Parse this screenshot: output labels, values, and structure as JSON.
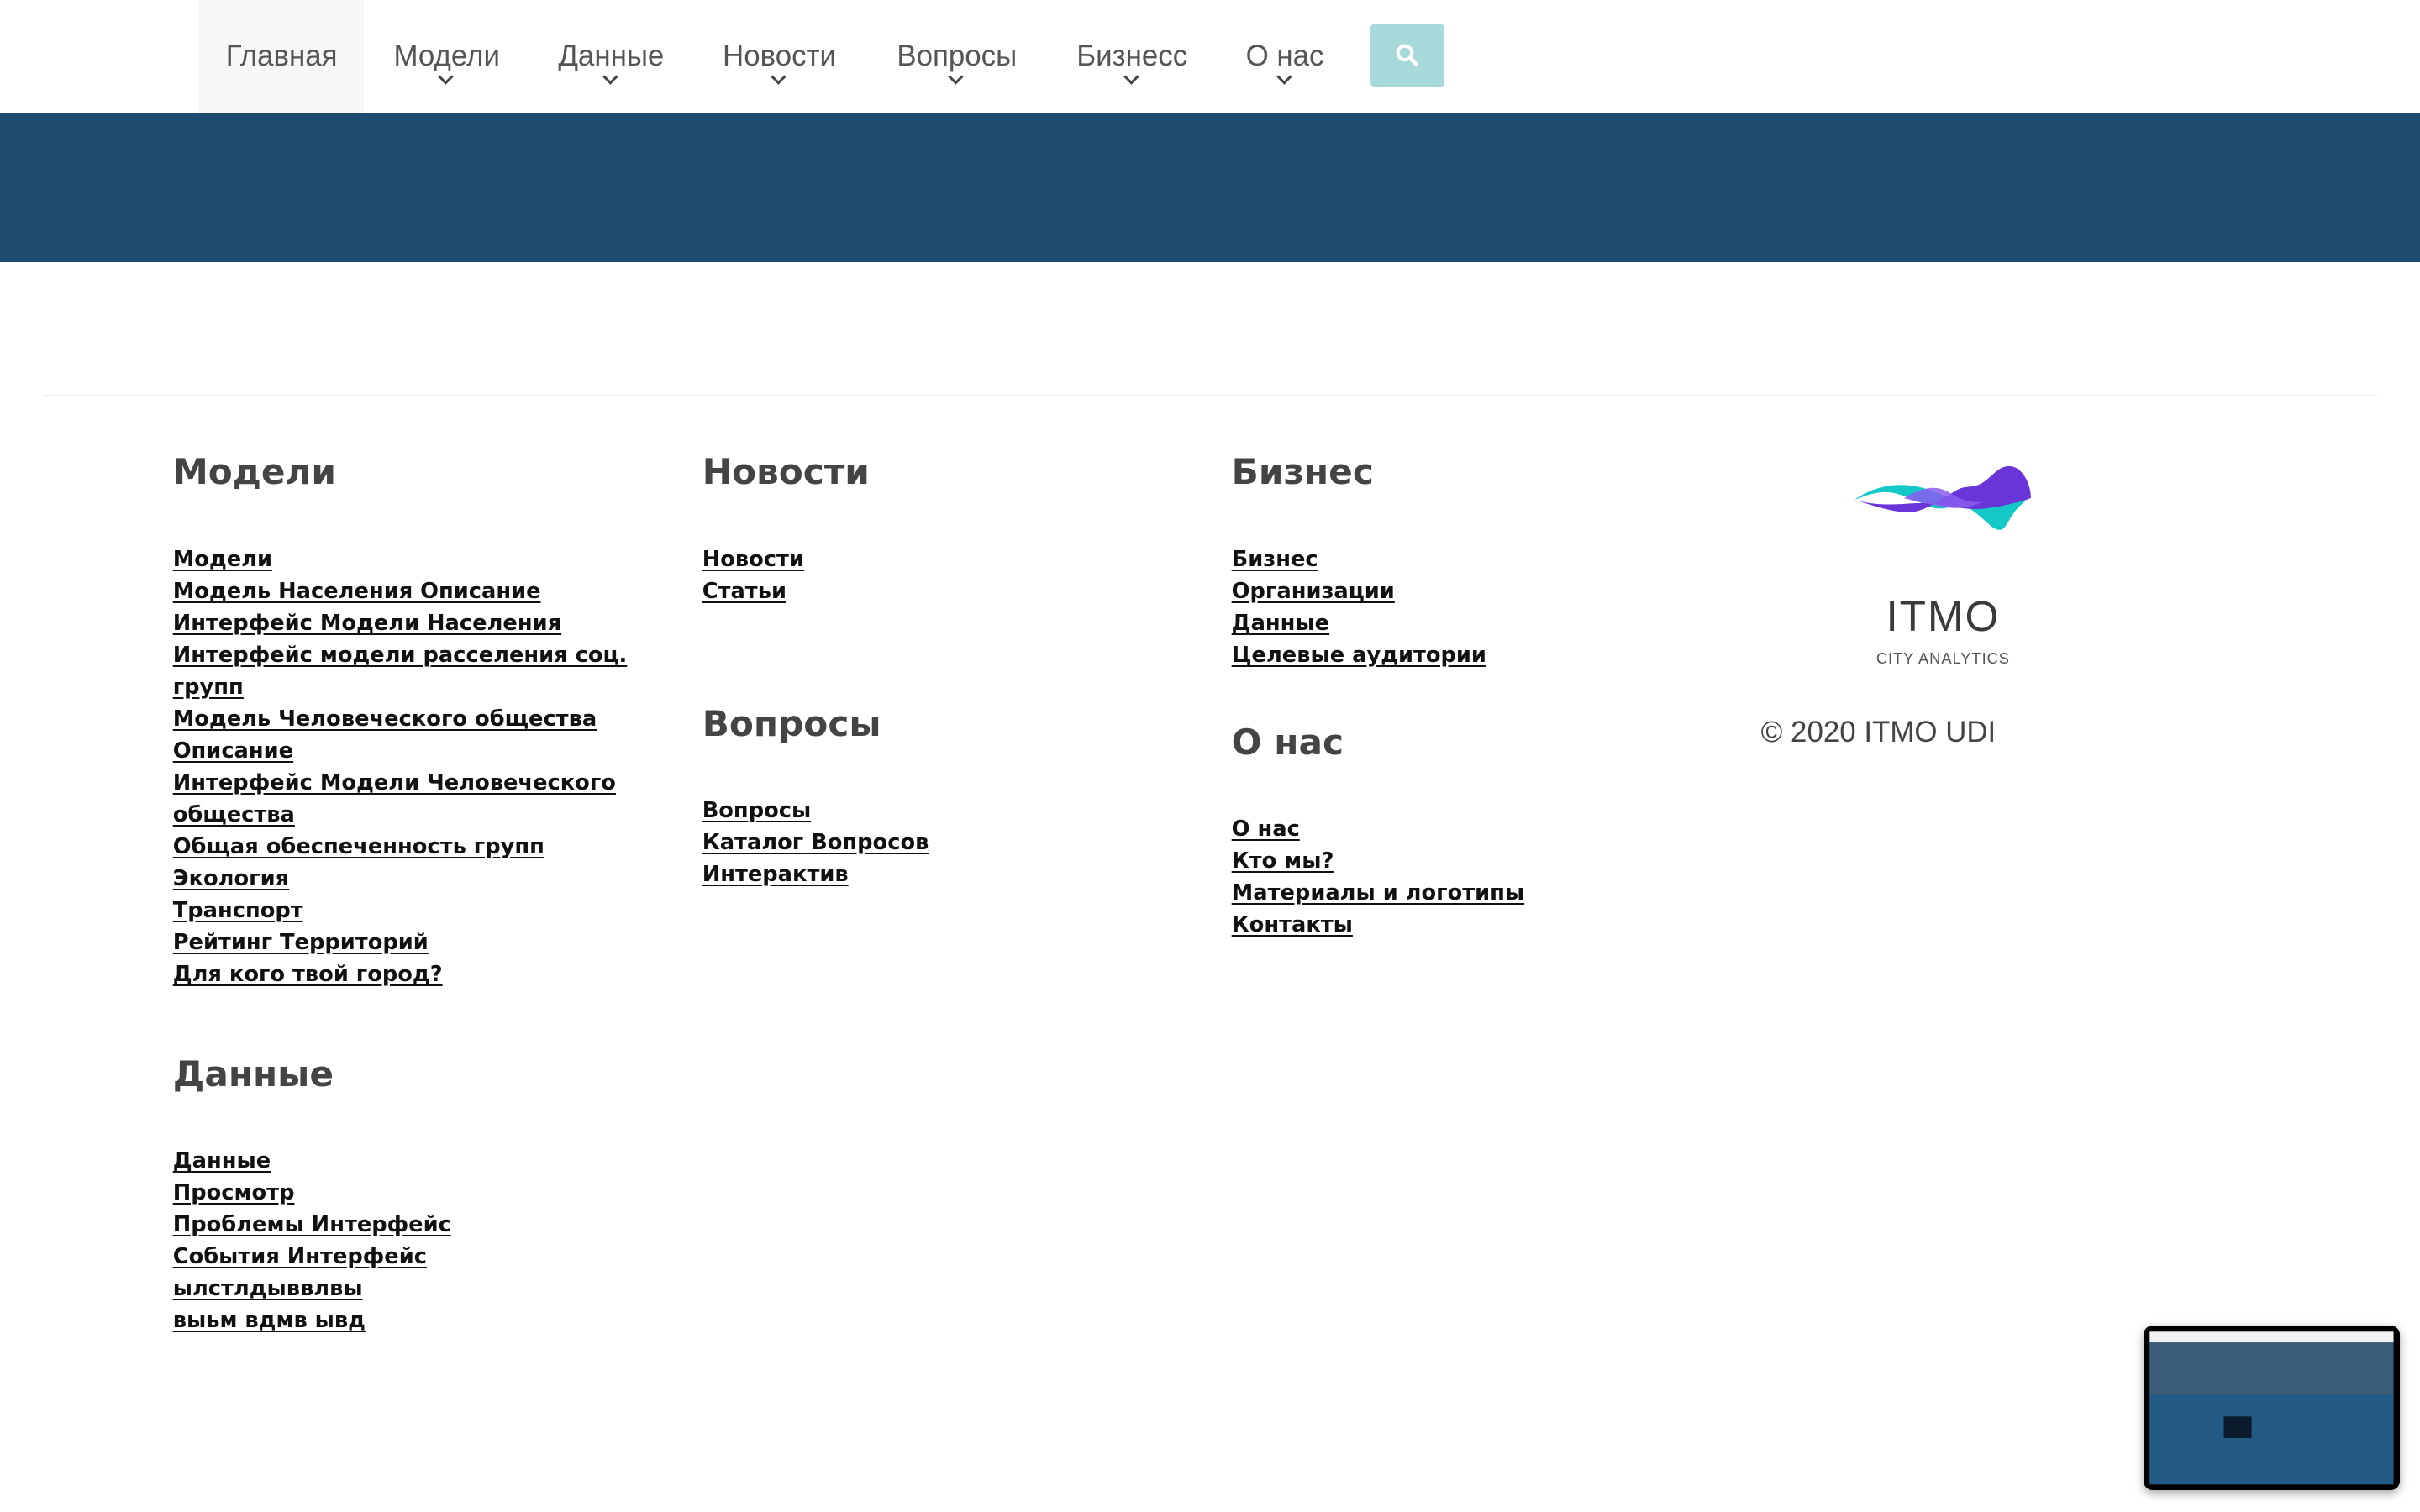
{
  "nav": {
    "items": [
      {
        "label": "Главная",
        "active": true,
        "dropdown": false
      },
      {
        "label": "Модели",
        "active": false,
        "dropdown": true
      },
      {
        "label": "Данные",
        "active": false,
        "dropdown": true
      },
      {
        "label": "Новости",
        "active": false,
        "dropdown": true
      },
      {
        "label": "Вопросы",
        "active": false,
        "dropdown": true
      },
      {
        "label": "Бизнесс",
        "active": false,
        "dropdown": true
      },
      {
        "label": "О нас",
        "active": false,
        "dropdown": true
      }
    ],
    "search_icon": "search-icon",
    "search_color": "#a7d9db"
  },
  "hero": {
    "color": "#1f4b70"
  },
  "footer": {
    "models": {
      "title": "Модели",
      "links": [
        "Модели",
        "Модель Населения Описание",
        "Интерфейс Модели Населения",
        "Интерфейс модели расселения соц. групп",
        "Модель Человеческого общества Описание",
        "Интерфейс Модели Человеческого общества",
        "Общая обеспеченность групп",
        "Экология",
        "Транспорт",
        "Рейтинг Территорий",
        "Для кого твой город?"
      ]
    },
    "data": {
      "title": "Данные",
      "links": [
        "Данные",
        "Просмотр",
        "Проблемы Интерфейс",
        "События Интерфейс",
        "ылстлдыввлвы",
        "выьм вдмв ывд"
      ]
    },
    "news": {
      "title": "Новости",
      "links": [
        "Новости",
        "Статьи"
      ]
    },
    "questions": {
      "title": "Вопросы",
      "links": [
        "Вопросы",
        "Каталог Вопросов",
        "Интерактив"
      ]
    },
    "business": {
      "title": "Бизнес",
      "links": [
        "Бизнес",
        "Организации",
        "Данные",
        "Целевые аудитории"
      ]
    },
    "about": {
      "title": "О нас",
      "links": [
        "О нас",
        "Кто мы?",
        "Материалы и логотипы",
        "Контакты"
      ]
    },
    "logo": {
      "title": "ITMO",
      "subtitle": "CITY ANALYTICS",
      "colors": {
        "teal": "#14c8c8",
        "purple": "#6a35d8",
        "violet": "#8a5cf0"
      }
    },
    "copyright": "© 2020 ITMO UDI"
  }
}
